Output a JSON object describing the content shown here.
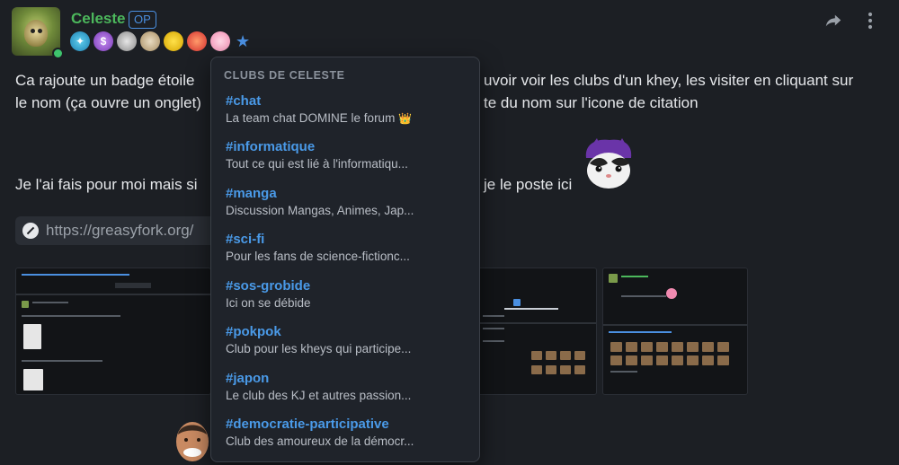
{
  "post": {
    "author": "Celeste",
    "op_badge": "OP",
    "author_status": "online",
    "badges": [
      "star-badge",
      "dollar-badge",
      "einstein-badge",
      "mummy-badge",
      "smiley-badge",
      "target-badge",
      "pink-face-badge"
    ],
    "accent_color": "#4a8fe0",
    "username_color": "#4cb85c",
    "text_lines": [
      "Ca rajoute un badge étoile",
      "uvoir voir les clubs d'un khey, les visiter en cliquant sur",
      "le nom (ça ouvre un onglet)",
      "te du nom sur l'icone de citation",
      "Je l'ai fais pour moi mais si",
      "je le poste ici"
    ],
    "link_url": "https://greasyfork.org/"
  },
  "clubs_panel": {
    "title": "CLUBS DE CELESTE",
    "clubs": [
      {
        "name": "#chat",
        "desc": "La team chat DOMINE le forum",
        "emoji": "👑"
      },
      {
        "name": "#informatique",
        "desc": "Tout ce qui est lié à l'informatiqu..."
      },
      {
        "name": "#manga",
        "desc": "Discussion Mangas, Animes, Jap..."
      },
      {
        "name": "#sci-fi",
        "desc": "Pour les fans de science-fictionc..."
      },
      {
        "name": "#sos-grobide",
        "desc": "Ici on se débide"
      },
      {
        "name": "#pokpok",
        "desc": "Club pour les kheys qui participe..."
      },
      {
        "name": "#japon",
        "desc": "Le club des KJ et autres passion..."
      },
      {
        "name": "#democratie-participative",
        "desc": "Club des amoureux de la démocr..."
      }
    ]
  }
}
